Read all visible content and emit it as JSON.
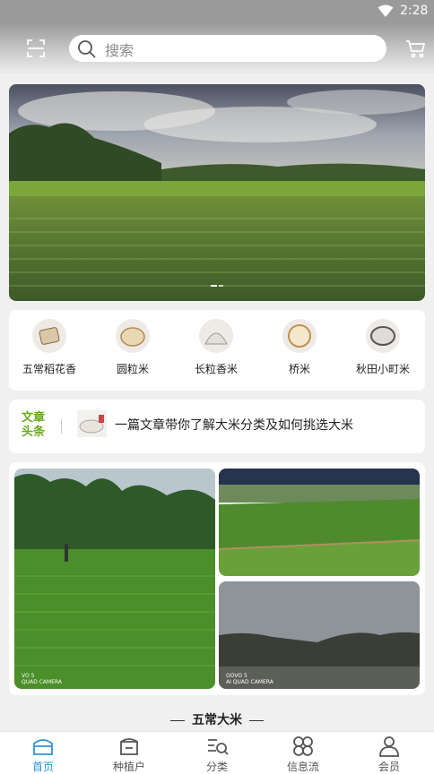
{
  "status_bar": {
    "time": "2:28"
  },
  "header": {
    "search_placeholder": "搜索"
  },
  "categories": [
    {
      "label": "五常稻花香"
    },
    {
      "label": "圆粒米"
    },
    {
      "label": "长粒香米"
    },
    {
      "label": "桥米"
    },
    {
      "label": "秋田小町米"
    }
  ],
  "news": {
    "tag": "文章头条",
    "headline": "一篇文章带你了解大米分类及如何挑选大米"
  },
  "photos": {
    "left_watermark": "VO 5\nQUAD CAMERA",
    "bottom_right_watermark": "OOVO 5\nAI QUAD CAMERA"
  },
  "section": {
    "title": "五常大米"
  },
  "nav": [
    {
      "label": "首页",
      "icon": "home-icon",
      "active": true
    },
    {
      "label": "种植户",
      "icon": "farmer-icon",
      "active": false
    },
    {
      "label": "分类",
      "icon": "category-icon",
      "active": false
    },
    {
      "label": "信息流",
      "icon": "feed-icon",
      "active": false
    },
    {
      "label": "会员",
      "icon": "member-icon",
      "active": false
    }
  ],
  "colors": {
    "accent": "#2f93d8",
    "tag_green": "#6aaa1c"
  }
}
